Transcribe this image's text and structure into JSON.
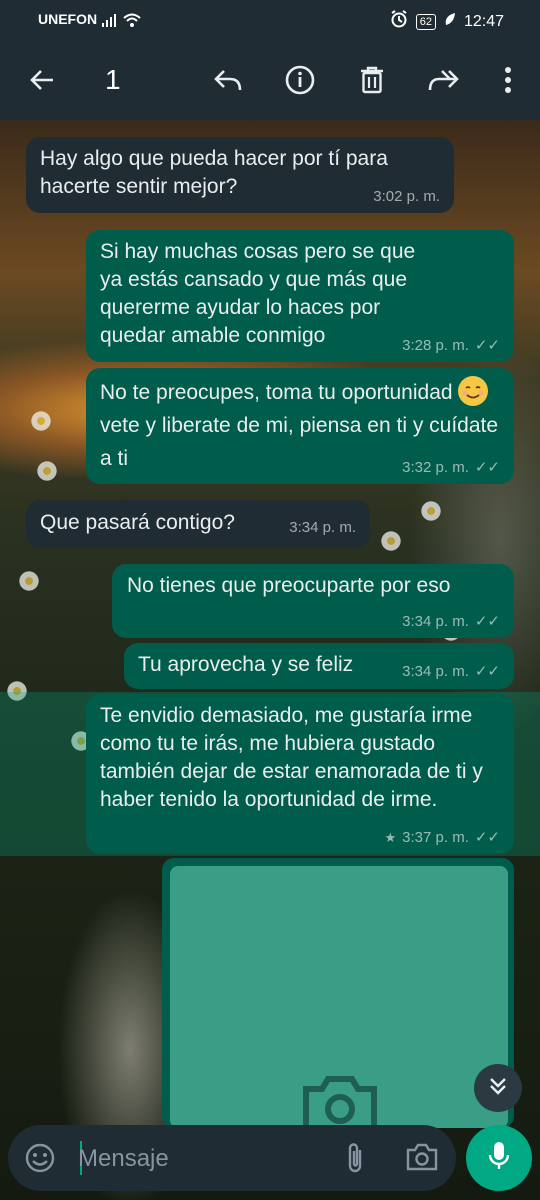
{
  "status_bar": {
    "carrier": "UNEFON",
    "battery": "62",
    "time": "12:47"
  },
  "app_bar": {
    "selected_count": "1",
    "icons": [
      "back-arrow-icon",
      "reply-icon",
      "info-icon",
      "delete-icon",
      "forward-icon",
      "more-vert-icon"
    ]
  },
  "messages": [
    {
      "direction": "in",
      "text": "Hay algo que pueda hacer por tí para hacerte sentir mejor?",
      "time": "3:02 p. m."
    },
    {
      "direction": "out",
      "text": "Si hay muchas cosas pero se que ya estás cansado y que más que quererme ayudar lo haces por quedar amable conmigo",
      "time": "3:28 p. m.",
      "ticks": "✓✓"
    },
    {
      "direction": "out",
      "text_before_emoji": "No te preocupes, toma tu oportunidad",
      "text_after_emoji": " vete y liberate de mi, piensa en ti y cuídate a ti",
      "emoji": "smiling-blush-emoji",
      "time": "3:32 p. m.",
      "ticks": "✓✓"
    },
    {
      "direction": "in",
      "text": "Que pasará contigo?",
      "time": "3:34 p. m."
    },
    {
      "direction": "out",
      "text": "No tienes que preocuparte por eso",
      "time": "3:34 p. m.",
      "ticks": "✓✓"
    },
    {
      "direction": "out",
      "text": "Tu aprovecha y se feliz",
      "time": "3:34 p. m.",
      "ticks": "✓✓"
    },
    {
      "direction": "out",
      "text": "Te envidio demasiado, me gustaría irme como tu te irás, me hubiera gustado también dejar de estar enamorada de ti y haber tenido la oportunidad de irme.",
      "time": "3:37 p. m.",
      "ticks": "✓✓",
      "starred": "★",
      "selected": true
    }
  ],
  "image_message": {
    "placeholder_icon": "camera-icon"
  },
  "composer": {
    "placeholder": "Mensaje",
    "value": ""
  },
  "colors": {
    "header": "#1f2c34",
    "incoming_bubble": "#1f2c34",
    "outgoing_bubble": "#005c4b",
    "accent": "#00a884"
  }
}
